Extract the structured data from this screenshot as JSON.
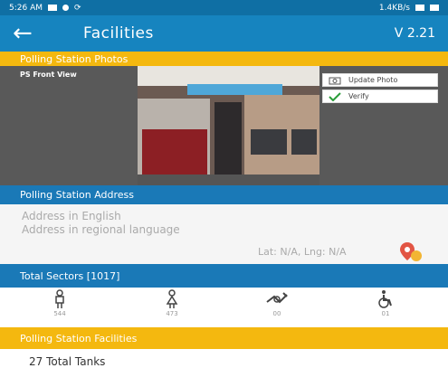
{
  "status_bar": {
    "time": "5:26 AM",
    "right_text": "1.4KB/s"
  },
  "app_bar": {
    "title": "Facilities",
    "version": "V 2.21"
  },
  "photos_section": {
    "header": "Polling Station Photos",
    "photo_label": "PS Front View",
    "update_button": "Update Photo",
    "verify_button": "Verify"
  },
  "address_section": {
    "header": "Polling Station Address",
    "address_english": "Address in English",
    "address_regional": "Address in regional language",
    "lat_lng": "Lat: N/A, Lng: N/A"
  },
  "sectors_section": {
    "header": "Total Sectors [1017]",
    "items": [
      {
        "icon": "male-icon",
        "count": "544"
      },
      {
        "icon": "female-icon",
        "count": "473"
      },
      {
        "icon": "third-gender-icon",
        "count": "00"
      },
      {
        "icon": "wheelchair-icon",
        "count": "01"
      }
    ]
  },
  "facilities_section": {
    "header": "Polling Station Facilities",
    "first_item": "27 Total Tanks"
  },
  "colors": {
    "app_bar": "#1684bf",
    "section_blue": "#1a79b7",
    "section_yellow": "#f4b80f"
  }
}
